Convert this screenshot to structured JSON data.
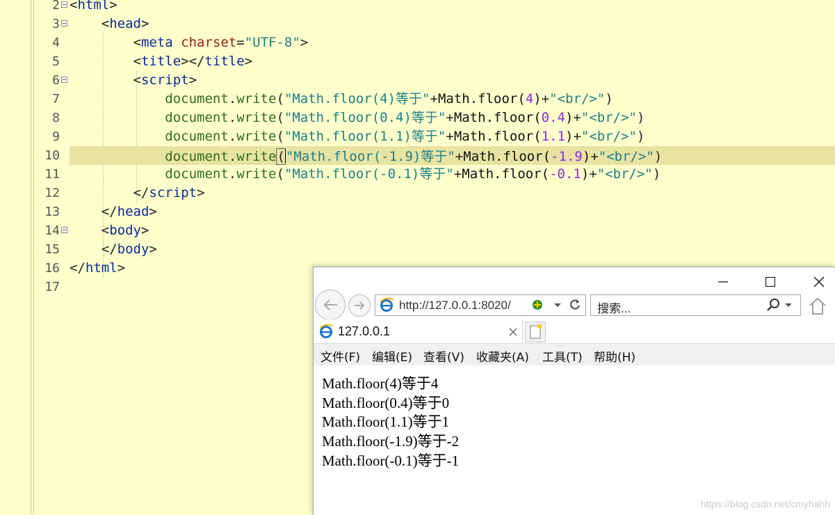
{
  "editor": {
    "line_numbers": [
      "2",
      "3",
      "4",
      "5",
      "6",
      "7",
      "8",
      "9",
      "10",
      "11",
      "12",
      "13",
      "14",
      "15",
      "16",
      "17"
    ],
    "lines": [
      [
        {
          "t": "<",
          "c": "t-pun"
        },
        {
          "t": "html",
          "c": "t-tag"
        },
        {
          "t": ">",
          "c": "t-pun"
        }
      ],
      [
        {
          "t": "    <",
          "c": "t-pun"
        },
        {
          "t": "head",
          "c": "t-tag"
        },
        {
          "t": ">",
          "c": "t-pun"
        }
      ],
      [
        {
          "t": "        <",
          "c": "t-pun"
        },
        {
          "t": "meta",
          "c": "t-tag"
        },
        {
          "t": " ",
          "c": "t-pun"
        },
        {
          "t": "charset",
          "c": "t-attr"
        },
        {
          "t": "=",
          "c": "t-pun"
        },
        {
          "t": "\"UTF-8\"",
          "c": "t-str"
        },
        {
          "t": ">",
          "c": "t-pun"
        }
      ],
      [
        {
          "t": "        <",
          "c": "t-pun"
        },
        {
          "t": "title",
          "c": "t-tag"
        },
        {
          "t": "></",
          "c": "t-pun"
        },
        {
          "t": "title",
          "c": "t-tag"
        },
        {
          "t": ">",
          "c": "t-pun"
        }
      ],
      [
        {
          "t": "        <",
          "c": "t-pun"
        },
        {
          "t": "script",
          "c": "t-tag"
        },
        {
          "t": ">",
          "c": "t-pun"
        }
      ],
      [
        {
          "t": "            document",
          "c": "t-fn"
        },
        {
          "t": ".",
          "c": "t-pun"
        },
        {
          "t": "write",
          "c": "t-fn"
        },
        {
          "t": "(",
          "c": "t-pun"
        },
        {
          "t": "\"Math.floor(4)等于\"",
          "c": "t-str"
        },
        {
          "t": "+",
          "c": "t-pun"
        },
        {
          "t": "Math.floor(",
          "c": "t-math"
        },
        {
          "t": "4",
          "c": "t-num"
        },
        {
          "t": ")",
          "c": "t-math"
        },
        {
          "t": "+",
          "c": "t-pun"
        },
        {
          "t": "\"<br/>\"",
          "c": "t-str"
        },
        {
          "t": ")",
          "c": "t-pun"
        }
      ],
      [
        {
          "t": "            document",
          "c": "t-fn"
        },
        {
          "t": ".",
          "c": "t-pun"
        },
        {
          "t": "write",
          "c": "t-fn"
        },
        {
          "t": "(",
          "c": "t-pun"
        },
        {
          "t": "\"Math.floor(0.4)等于\"",
          "c": "t-str"
        },
        {
          "t": "+",
          "c": "t-pun"
        },
        {
          "t": "Math.floor(",
          "c": "t-math"
        },
        {
          "t": "0.4",
          "c": "t-num"
        },
        {
          "t": ")",
          "c": "t-math"
        },
        {
          "t": "+",
          "c": "t-pun"
        },
        {
          "t": "\"<br/>\"",
          "c": "t-str"
        },
        {
          "t": ")",
          "c": "t-pun"
        }
      ],
      [
        {
          "t": "            document",
          "c": "t-fn"
        },
        {
          "t": ".",
          "c": "t-pun"
        },
        {
          "t": "write",
          "c": "t-fn"
        },
        {
          "t": "(",
          "c": "t-pun"
        },
        {
          "t": "\"Math.floor(1.1)等于\"",
          "c": "t-str"
        },
        {
          "t": "+",
          "c": "t-pun"
        },
        {
          "t": "Math.floor(",
          "c": "t-math"
        },
        {
          "t": "1.1",
          "c": "t-num"
        },
        {
          "t": ")",
          "c": "t-math"
        },
        {
          "t": "+",
          "c": "t-pun"
        },
        {
          "t": "\"<br/>\"",
          "c": "t-str"
        },
        {
          "t": ")",
          "c": "t-pun"
        }
      ],
      [
        {
          "t": "            document",
          "c": "t-fn"
        },
        {
          "t": ".",
          "c": "t-pun"
        },
        {
          "t": "write",
          "c": "t-fn"
        },
        {
          "t": "(",
          "c": "t-pun"
        },
        {
          "t": "\"Math.floor(-1.9)等于\"",
          "c": "t-str"
        },
        {
          "t": "+",
          "c": "t-pun"
        },
        {
          "t": "Math.floor(",
          "c": "t-math"
        },
        {
          "t": "-1.9",
          "c": "t-num"
        },
        {
          "t": ")",
          "c": "t-math"
        },
        {
          "t": "+",
          "c": "t-pun"
        },
        {
          "t": "\"<br/>\"",
          "c": "t-str"
        },
        {
          "t": ")",
          "c": "t-pun"
        }
      ],
      [
        {
          "t": "            document",
          "c": "t-fn"
        },
        {
          "t": ".",
          "c": "t-pun"
        },
        {
          "t": "write",
          "c": "t-fn"
        },
        {
          "t": "(",
          "c": "t-pun"
        },
        {
          "t": "\"Math.floor(-0.1)等于\"",
          "c": "t-str"
        },
        {
          "t": "+",
          "c": "t-pun"
        },
        {
          "t": "Math.floor(",
          "c": "t-math"
        },
        {
          "t": "-0.1",
          "c": "t-num"
        },
        {
          "t": ")",
          "c": "t-math"
        },
        {
          "t": "+",
          "c": "t-pun"
        },
        {
          "t": "\"<br/>\"",
          "c": "t-str"
        },
        {
          "t": ")",
          "c": "t-pun"
        }
      ],
      [
        {
          "t": "        </",
          "c": "t-pun"
        },
        {
          "t": "script",
          "c": "t-tag"
        },
        {
          "t": ">",
          "c": "t-pun"
        }
      ],
      [
        {
          "t": "    </",
          "c": "t-pun"
        },
        {
          "t": "head",
          "c": "t-tag"
        },
        {
          "t": ">",
          "c": "t-pun"
        }
      ],
      [
        {
          "t": "    <",
          "c": "t-pun"
        },
        {
          "t": "body",
          "c": "t-tag"
        },
        {
          "t": ">",
          "c": "t-pun"
        }
      ],
      [
        {
          "t": "    </",
          "c": "t-pun"
        },
        {
          "t": "body",
          "c": "t-tag"
        },
        {
          "t": ">",
          "c": "t-pun"
        }
      ],
      [
        {
          "t": "</",
          "c": "t-pun"
        },
        {
          "t": "html",
          "c": "t-tag"
        },
        {
          "t": ">",
          "c": "t-pun"
        }
      ],
      []
    ],
    "current_line": "10",
    "fold_lines": [
      "2",
      "3",
      "6",
      "14"
    ]
  },
  "browser": {
    "address": "http://127.0.0.1:8020/",
    "search_placeholder": "搜索...",
    "tab_title": "127.0.0.1",
    "menu": [
      "文件(F)",
      "编辑(E)",
      "查看(V)",
      "收藏夹(A)",
      "工具(T)",
      "帮助(H)"
    ],
    "output": [
      "Math.floor(4)等于4",
      "Math.floor(0.4)等于0",
      "Math.floor(1.1)等于1",
      "Math.floor(-1.9)等于-2",
      "Math.floor(-0.1)等于-1"
    ],
    "watermark": "https://blog.csdn.net/cmyhahh"
  },
  "colors": {
    "editor_bg": "#ffffcc",
    "current_line": "#e8e3a2",
    "tag": "#0a2a9b",
    "attr": "#9b1c1c",
    "string": "#1b7f8a",
    "function": "#2e6e1f",
    "number": "#8a2be2"
  }
}
